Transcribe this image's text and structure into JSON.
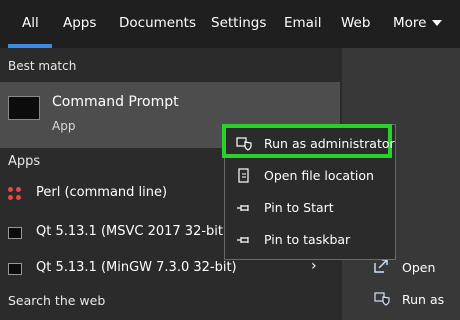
{
  "tabs": [
    {
      "label": "All"
    },
    {
      "label": "Apps"
    },
    {
      "label": "Documents"
    },
    {
      "label": "Settings"
    },
    {
      "label": "Email"
    },
    {
      "label": "Web"
    },
    {
      "label": "More"
    }
  ],
  "best_match": {
    "section_label": "Best match",
    "title": "Command Prompt",
    "subtitle": "App"
  },
  "apps": {
    "section_label": "Apps",
    "items": [
      {
        "label": "Perl (command line)"
      },
      {
        "label": "Qt 5.13.1 (MSVC 2017 32-bit"
      },
      {
        "label": "Qt 5.13.1 (MinGW 7.3.0 32-bit)"
      }
    ]
  },
  "search_web": {
    "section_label": "Search the web"
  },
  "context_menu": {
    "items": [
      {
        "label": "Run as administrator",
        "icon": "shield-icon"
      },
      {
        "label": "Open file location",
        "icon": "file-location-icon"
      },
      {
        "label": "Pin to Start",
        "icon": "pin-icon"
      },
      {
        "label": "Pin to taskbar",
        "icon": "pin-icon"
      }
    ]
  },
  "right_panel": {
    "items": [
      {
        "label": "Open",
        "icon": "open-icon"
      },
      {
        "label": "Run as",
        "icon": "shield-icon"
      }
    ]
  },
  "colors": {
    "accent": "#3c8be0",
    "highlight": "#2ad12a",
    "selected_row": "#4d4d4d"
  }
}
